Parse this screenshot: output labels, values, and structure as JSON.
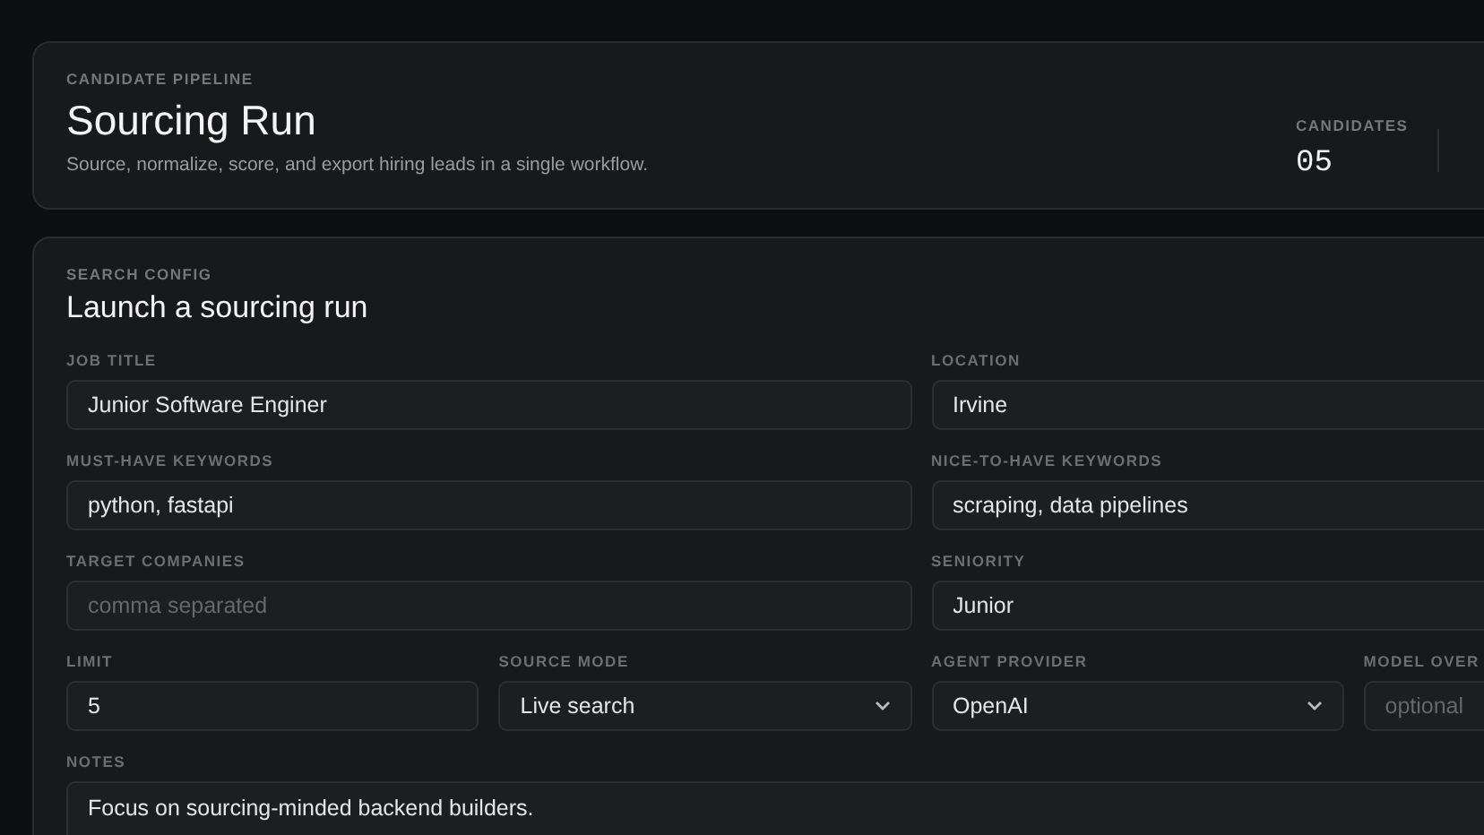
{
  "header": {
    "eyebrow": "CANDIDATE PIPELINE",
    "title": "Sourcing Run",
    "subtitle": "Source, normalize, score, and export hiring leads in a single workflow.",
    "stats": [
      {
        "label": "CANDIDATES",
        "value": "05"
      }
    ]
  },
  "config": {
    "eyebrow": "SEARCH CONFIG",
    "title": "Launch a sourcing run",
    "rows": [
      [
        {
          "label": "JOB TITLE",
          "kind": "text",
          "value": "Junior Software Enginer"
        },
        {
          "label": "LOCATION",
          "kind": "text",
          "value": "Irvine"
        }
      ],
      [
        {
          "label": "MUST-HAVE KEYWORDS",
          "kind": "text",
          "value": "python, fastapi"
        },
        {
          "label": "NICE-TO-HAVE KEYWORDS",
          "kind": "text",
          "value": "scraping, data pipelines"
        }
      ],
      [
        {
          "label": "TARGET COMPANIES",
          "kind": "text",
          "placeholder": "comma separated"
        },
        {
          "label": "SENIORITY",
          "kind": "text",
          "value": "Junior"
        }
      ],
      [
        {
          "label": "LIMIT",
          "kind": "text",
          "value": "5"
        },
        {
          "label": "SOURCE MODE",
          "kind": "select",
          "value": "Live search"
        },
        {
          "label": "AGENT PROVIDER",
          "kind": "select",
          "value": "OpenAI"
        },
        {
          "label": "MODEL OVER",
          "kind": "text",
          "placeholder": "optional"
        }
      ],
      [
        {
          "label": "NOTES",
          "kind": "textarea",
          "value": "Focus on sourcing-minded backend builders."
        }
      ]
    ]
  }
}
